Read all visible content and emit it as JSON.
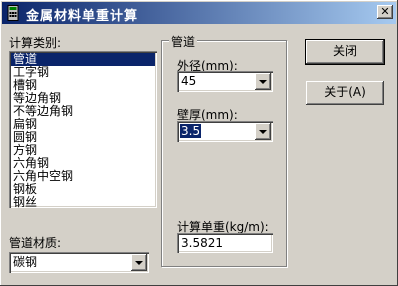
{
  "window": {
    "title": "金属材料单重计算"
  },
  "calc_type": {
    "label": "计算类别:",
    "items": [
      "管道",
      "工字钢",
      "槽钢",
      "等边角钢",
      "不等边角钢",
      "扁钢",
      "圆钢",
      "方钢",
      "六角钢",
      "六角中空钢",
      "钢板",
      "钢丝"
    ],
    "selected_index": 0
  },
  "material": {
    "label": "管道材质:",
    "value": "碳钢"
  },
  "group": {
    "title": "管道"
  },
  "outer_diameter": {
    "label": "外径(mm):",
    "value": "45"
  },
  "wall_thickness": {
    "label": "壁厚(mm):",
    "value": "3.5"
  },
  "unit_weight": {
    "label": "计算单重(kg/m):",
    "value": "3.5821"
  },
  "buttons": {
    "close": "关闭",
    "about": "关于(A)"
  },
  "colors": {
    "titlebar_start": "#0a246a",
    "titlebar_end": "#a6caf0",
    "selection": "#0a246a",
    "face": "#d4d0c8"
  }
}
